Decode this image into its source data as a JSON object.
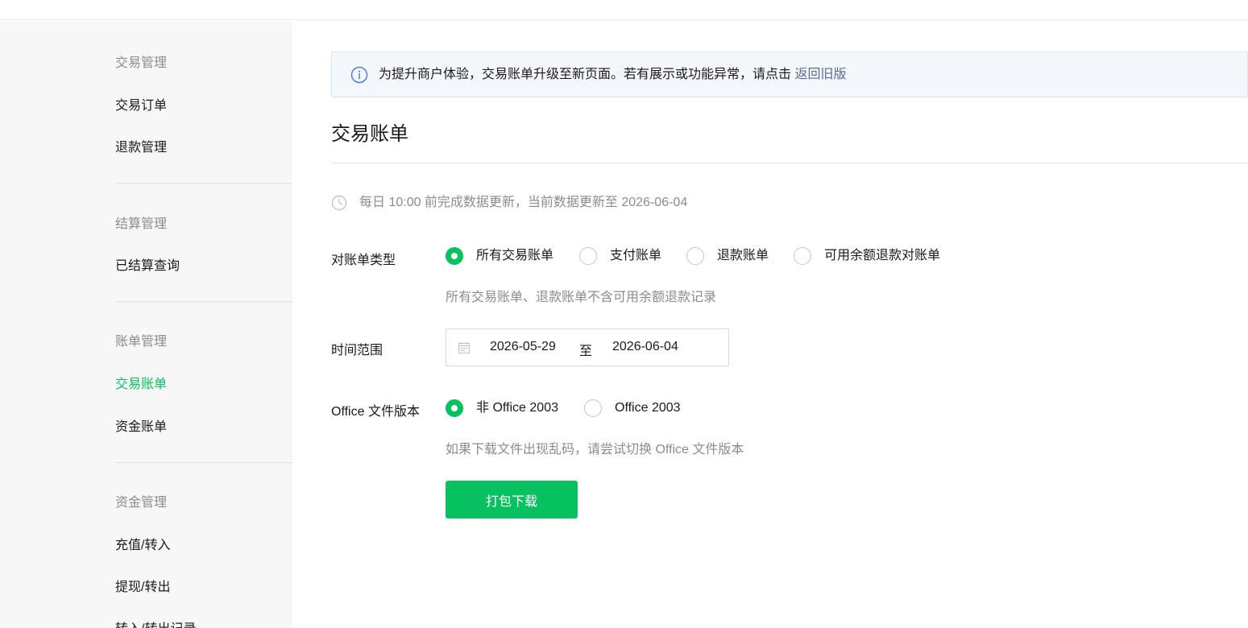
{
  "sidebar": {
    "groups": [
      {
        "title": "交易管理",
        "items": [
          "交易订单",
          "退款管理"
        ]
      },
      {
        "title": "结算管理",
        "items": [
          "已结算查询"
        ]
      },
      {
        "title": "账单管理",
        "items": [
          "交易账单",
          "资金账单"
        ]
      },
      {
        "title": "资金管理",
        "items": [
          "充值/转入",
          "提现/转出",
          "转入/转出记录"
        ]
      }
    ],
    "active_item": "交易账单"
  },
  "notice": {
    "text": "为提升商户体验，交易账单升级至新页面。若有展示或功能异常，请点击",
    "link": "返回旧版"
  },
  "page": {
    "title": "交易账单",
    "update_text": "每日 10:00 前完成数据更新，当前数据更新至 2026-06-04"
  },
  "form": {
    "bill_type": {
      "label": "对账单类型",
      "options": [
        "所有交易账单",
        "支付账单",
        "退款账单",
        "可用余额退款对账单"
      ],
      "selected": "所有交易账单",
      "hint": "所有交易账单、退款账单不含可用余额退款记录"
    },
    "time_range": {
      "label": "时间范围",
      "start": "2026-05-29",
      "separator": "至",
      "end": "2026-06-04"
    },
    "office_version": {
      "label": "Office 文件版本",
      "options": [
        "非 Office 2003",
        "Office 2003"
      ],
      "selected": "非 Office 2003",
      "hint": "如果下载文件出现乱码，请尝试切换 Office 文件版本"
    },
    "download_button": "打包下载"
  },
  "colors": {
    "accent": "#07c160",
    "link": "#576b95",
    "notice_bg": "#f4f8fd",
    "sidebar_bg": "#f7f7f7",
    "muted_text": "#8c8c8c"
  }
}
